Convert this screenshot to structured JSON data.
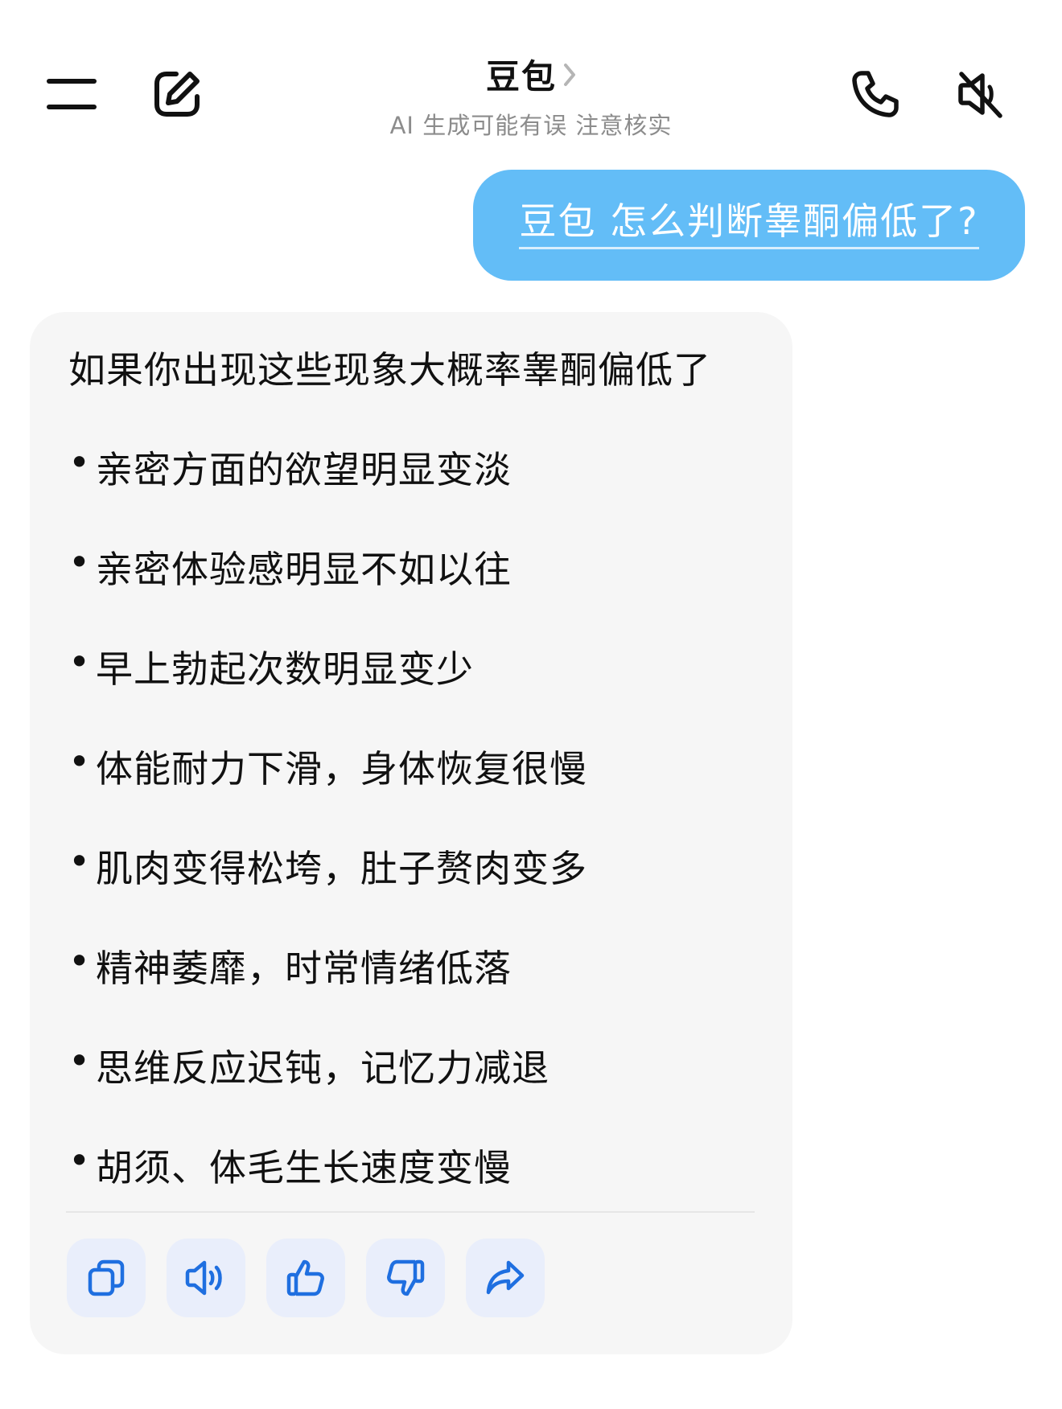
{
  "header": {
    "title": "豆包",
    "title_chevron": "〉",
    "subtitle": "AI 生成可能有误 注意核实",
    "icons": {
      "menu": "menu-icon",
      "compose": "compose-icon",
      "call": "phone-icon",
      "mute": "speaker-muted-icon"
    }
  },
  "conversation": {
    "user_message": "豆包 怎么判断睾酮偏低了?",
    "assistant": {
      "intro": "如果你出现这些现象大概率睾酮偏低了",
      "bullet": "•",
      "items": [
        "亲密方面的欲望明显变淡",
        "亲密体验感明显不如以往",
        "早上勃起次数明显变少",
        "体能耐力下滑，身体恢复很慢",
        "肌肉变得松垮，肚子赘肉变多",
        "精神萎靡，时常情绪低落",
        "思维反应迟钝，记忆力减退",
        "胡须、体毛生长速度变慢"
      ],
      "actions": [
        "copy-icon",
        "speaker-icon",
        "thumbs-up-icon",
        "thumbs-down-icon",
        "share-icon"
      ]
    }
  },
  "colors": {
    "user_bubble": "#63bdf7",
    "card_background": "#f6f6f6",
    "action_button": "#e9eefb",
    "action_icon": "#1f6fe0",
    "subtitle": "#8c8c8c"
  }
}
